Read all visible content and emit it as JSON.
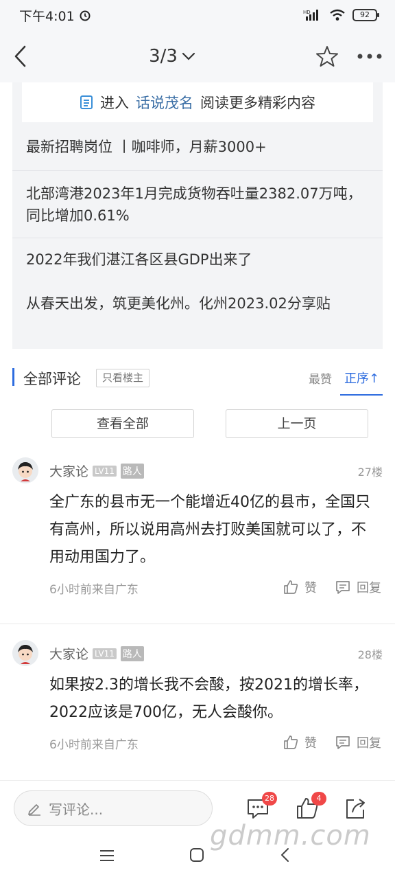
{
  "status_bar": {
    "time": "下午4:01",
    "battery": "92"
  },
  "nav": {
    "page_indicator": "3/3"
  },
  "related": {
    "read_more_prefix": "进入",
    "read_more_link": "话说茂名",
    "read_more_suffix": "阅读更多精彩内容",
    "items": [
      "最新招聘岗位 丨咖啡师，月薪3000+",
      "北部湾港2023年1月完成货物吞吐量2382.07万吨，同比增加0.61%",
      "2022年我们湛江各区县GDP出来了",
      "从春天出发，筑更美化州。化州2023.02分享贴"
    ]
  },
  "comments_header": {
    "title": "全部评论",
    "only_op": "只看楼主",
    "sort_hot": "最赞",
    "sort_order": "正序↑"
  },
  "pager": {
    "view_all": "查看全部",
    "prev_page": "上一页"
  },
  "comments": [
    {
      "user": "大家论",
      "level": "LV11",
      "role": "路人",
      "floor": "27楼",
      "text": "全广东的县市无一个能增近40亿的县市，全国只有高州，所以说用高州去打败美国就可以了，不用动用国力了。",
      "meta": "6小时前来自广东",
      "like": "赞",
      "reply": "回复"
    },
    {
      "user": "大家论",
      "level": "LV11",
      "role": "路人",
      "floor": "28楼",
      "text": "如果按2.3的增长我不会酸，按2021的增长率，2022应该是700亿，无人会酸你。",
      "meta": "6小时前来自广东",
      "like": "赞",
      "reply": "回复"
    }
  ],
  "bottom_bar": {
    "input_placeholder": "写评论...",
    "comment_count": "28",
    "like_count": "4"
  },
  "watermark": "gdmm.com",
  "colors": {
    "accent": "#2d6cdf",
    "link": "#3a6ea5",
    "badge": "#f04848"
  }
}
